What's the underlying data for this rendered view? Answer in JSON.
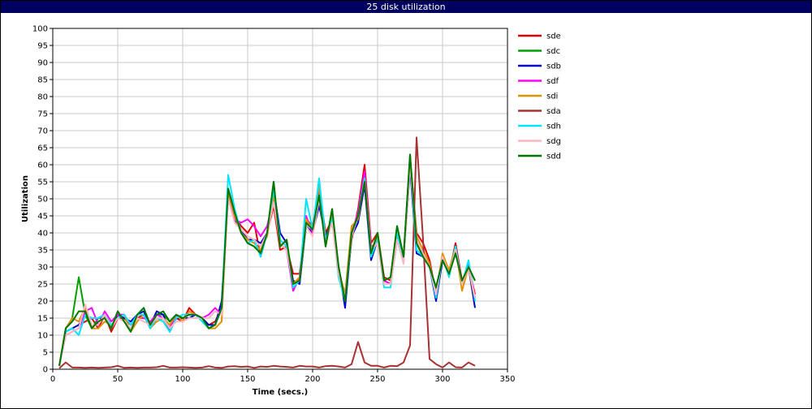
{
  "chart_data": {
    "type": "line",
    "title": "25 disk utilization",
    "xlabel": "Time (secs.)",
    "ylabel": "Utilization",
    "xlim": [
      0,
      350
    ],
    "ylim": [
      0,
      100
    ],
    "x_ticks": [
      0,
      50,
      100,
      150,
      200,
      250,
      300,
      350
    ],
    "y_ticks": [
      0,
      5,
      10,
      15,
      20,
      25,
      30,
      35,
      40,
      45,
      50,
      55,
      60,
      65,
      70,
      75,
      80,
      85,
      90,
      95,
      100
    ],
    "grid": true,
    "legend_position": "right",
    "x": [
      5,
      10,
      15,
      20,
      25,
      30,
      35,
      40,
      45,
      50,
      55,
      60,
      65,
      70,
      75,
      80,
      85,
      90,
      95,
      100,
      105,
      110,
      115,
      120,
      125,
      130,
      135,
      140,
      145,
      150,
      155,
      160,
      165,
      170,
      175,
      180,
      185,
      190,
      195,
      200,
      205,
      210,
      215,
      220,
      225,
      230,
      235,
      240,
      245,
      250,
      255,
      260,
      265,
      270,
      275,
      280,
      285,
      290,
      295,
      300,
      305,
      310,
      315,
      320,
      325
    ],
    "series": [
      {
        "name": "sde",
        "color": "#e00000",
        "values": [
          1,
          11,
          12,
          13,
          14,
          15,
          12,
          16,
          11,
          15,
          15,
          13,
          15,
          16,
          12,
          15,
          15,
          12,
          15,
          14,
          18,
          16,
          15,
          13,
          14,
          18,
          51,
          45,
          42,
          40,
          43,
          33,
          40,
          48,
          35,
          36,
          28,
          28,
          44,
          42,
          53,
          40,
          44,
          30,
          20,
          38,
          47,
          60,
          37,
          40,
          27,
          26,
          39,
          33,
          62,
          40,
          37,
          32,
          22,
          33,
          28,
          37,
          26,
          30,
          22
        ]
      },
      {
        "name": "sdc",
        "color": "#00a000",
        "values": [
          1,
          12,
          15,
          27,
          16,
          12,
          15,
          15,
          12,
          17,
          14,
          11,
          16,
          18,
          13,
          16,
          16,
          14,
          16,
          15,
          16,
          16,
          15,
          12,
          13,
          18,
          53,
          46,
          40,
          37,
          36,
          34,
          40,
          55,
          36,
          38,
          25,
          26,
          43,
          41,
          51,
          36,
          47,
          30,
          20,
          40,
          45,
          55,
          34,
          40,
          26,
          27,
          42,
          33,
          63,
          37,
          33,
          30,
          24,
          32,
          28,
          34,
          26,
          30,
          26
        ]
      },
      {
        "name": "sdb",
        "color": "#0000c8",
        "values": [
          1,
          11,
          12,
          13,
          16,
          15,
          15,
          16,
          12,
          16,
          15,
          14,
          16,
          17,
          13,
          17,
          16,
          11,
          15,
          15,
          15,
          16,
          15,
          13,
          13,
          20,
          50,
          44,
          41,
          38,
          38,
          37,
          40,
          53,
          40,
          37,
          26,
          25,
          42,
          40,
          48,
          39,
          43,
          30,
          18,
          39,
          43,
          54,
          32,
          38,
          26,
          25,
          38,
          32,
          59,
          34,
          33,
          30,
          20,
          32,
          29,
          35,
          25,
          30,
          18
        ]
      },
      {
        "name": "sdf",
        "color": "#ff00ff",
        "values": [
          1,
          10,
          11,
          12,
          17,
          18,
          13,
          17,
          14,
          16,
          16,
          13,
          15,
          15,
          14,
          16,
          15,
          12,
          16,
          14,
          17,
          16,
          15,
          16,
          18,
          16,
          51,
          44,
          43,
          44,
          42,
          39,
          42,
          50,
          37,
          35,
          23,
          27,
          45,
          40,
          52,
          38,
          44,
          28,
          22,
          40,
          46,
          58,
          36,
          37,
          26,
          25,
          39,
          32,
          61,
          38,
          34,
          30,
          23,
          33,
          28,
          36,
          25,
          31,
          21
        ]
      },
      {
        "name": "sdi",
        "color": "#e09000",
        "values": [
          1,
          12,
          15,
          14,
          18,
          12,
          12,
          14,
          13,
          15,
          16,
          11,
          14,
          16,
          12,
          14,
          15,
          13,
          16,
          14,
          17,
          16,
          14,
          12,
          12,
          14,
          52,
          45,
          40,
          38,
          37,
          35,
          39,
          51,
          36,
          38,
          25,
          27,
          44,
          41,
          54,
          37,
          45,
          29,
          22,
          42,
          44,
          56,
          35,
          39,
          25,
          25,
          40,
          33,
          62,
          39,
          35,
          31,
          22,
          34,
          29,
          36,
          23,
          30,
          20
        ]
      },
      {
        "name": "sda",
        "color": "#a83232",
        "values": [
          0.3,
          2,
          0.5,
          0.5,
          0.4,
          0.5,
          0.4,
          0.5,
          0.6,
          1,
          0.4,
          0.5,
          0.4,
          0.5,
          0.5,
          0.6,
          1,
          0.5,
          0.5,
          0.6,
          0.5,
          0.4,
          0.5,
          0.9,
          0.5,
          0.4,
          0.8,
          0.9,
          0.7,
          0.8,
          0.4,
          0.8,
          0.7,
          1,
          0.8,
          0.7,
          0.5,
          1,
          0.8,
          0.8,
          0.5,
          0.9,
          1,
          0.8,
          0.5,
          1.5,
          8,
          2,
          1,
          1,
          0.5,
          1,
          0.9,
          2,
          7,
          68,
          38,
          3,
          1.5,
          0.5,
          2,
          0.6,
          0.5,
          2,
          1
        ]
      },
      {
        "name": "sdh",
        "color": "#00e5ff",
        "values": [
          1,
          11,
          12,
          10,
          16,
          15,
          15,
          16,
          13,
          15,
          16,
          13,
          16,
          16,
          12,
          15,
          14,
          11,
          15,
          16,
          16,
          16,
          14,
          12,
          13,
          18,
          57,
          47,
          40,
          37,
          38,
          33,
          40,
          53,
          38,
          36,
          24,
          26,
          50,
          41,
          56,
          38,
          44,
          27,
          20,
          39,
          45,
          56,
          33,
          38,
          24,
          24,
          40,
          31,
          61,
          35,
          33,
          30,
          21,
          33,
          27,
          36,
          25,
          32,
          20
        ]
      },
      {
        "name": "sdg",
        "color": "#ffb6c1",
        "values": [
          1,
          10,
          11,
          12,
          19,
          13,
          13,
          16,
          12,
          15,
          14,
          12,
          15,
          14,
          13,
          15,
          15,
          12,
          14,
          14,
          15,
          15,
          15,
          15,
          17,
          16,
          50,
          43,
          41,
          39,
          38,
          36,
          40,
          49,
          37,
          35,
          25,
          26,
          42,
          39,
          50,
          37,
          43,
          28,
          21,
          39,
          45,
          55,
          35,
          37,
          25,
          25,
          38,
          31,
          60,
          38,
          34,
          30,
          22,
          33,
          28,
          35,
          25,
          30,
          21
        ]
      },
      {
        "name": "sdd",
        "color": "#007800",
        "values": [
          1,
          12,
          14,
          17,
          17,
          12,
          14,
          15,
          12,
          17,
          14,
          11,
          16,
          18,
          13,
          16,
          17,
          14,
          16,
          15,
          16,
          16,
          15,
          12,
          13,
          18,
          53,
          46,
          40,
          37,
          36,
          34,
          40,
          55,
          36,
          38,
          25,
          26,
          43,
          41,
          51,
          36,
          47,
          30,
          20,
          40,
          45,
          55,
          34,
          40,
          26,
          27,
          42,
          33,
          63,
          37,
          33,
          30,
          24,
          32,
          28,
          34,
          26,
          30,
          26
        ]
      }
    ]
  }
}
